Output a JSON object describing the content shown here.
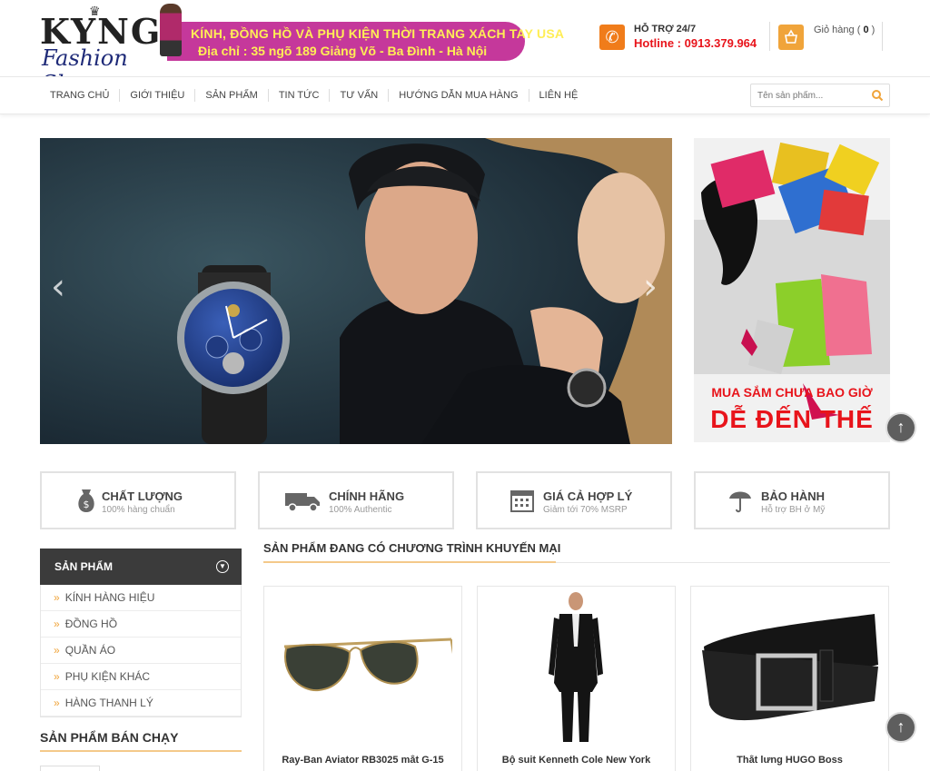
{
  "header": {
    "logo_main": "KYNG",
    "logo_sub": "Fashion Shop",
    "banner_line1": "KÍNH, ĐỒNG HỒ VÀ PHỤ KIỆN THỜI TRANG XÁCH TAY USA",
    "banner_line2": "Địa chỉ : 35 ngõ 189 Giảng Võ - Ba Đình - Hà Nội",
    "support_label": "HỖ TRỢ 24/7",
    "hotline": "Hotline : 0913.379.964",
    "cart_label": "Giỏ hàng (",
    "cart_count": "0",
    "cart_close": ")"
  },
  "nav": {
    "items": [
      "TRANG CHỦ",
      "GIỚI THIỆU",
      "SẢN PHẨM",
      "TIN TỨC",
      "TƯ VẤN",
      "HƯỚNG DẪN MUA HÀNG",
      "LIÊN HỆ"
    ],
    "search_placeholder": "Tên sản phẩm..."
  },
  "hero": {
    "side_banner_line1": "MUA SẮM CHƯA BAO GIỜ",
    "side_banner_line2": "DỄ ĐẾN THẾ",
    "arrow_prev": "‹",
    "arrow_next": "›"
  },
  "features": [
    {
      "title": "CHẤT LƯỢNG",
      "sub": "100% hàng chuẩn",
      "icon": "money-bag-icon"
    },
    {
      "title": "CHÍNH HÃNG",
      "sub": "100% Authentic",
      "icon": "truck-icon"
    },
    {
      "title": "GIÁ CẢ HỢP LÝ",
      "sub": "Giảm tới 70% MSRP",
      "icon": "calendar-icon"
    },
    {
      "title": "BẢO HÀNH",
      "sub": "Hỗ trợ BH ở Mỹ",
      "icon": "umbrella-icon"
    }
  ],
  "sidebar": {
    "title": "SẢN PHẨM",
    "items": [
      "KÍNH HÀNG HIỆU",
      "ĐỒNG HỒ",
      "QUẦN ÁO",
      "PHỤ KIỆN KHÁC",
      "HÀNG THANH LÝ"
    ],
    "best_title": "SẢN PHẨM BÁN CHẠY"
  },
  "promo": {
    "title": "SẢN PHẨM ĐANG CÓ CHƯƠNG TRÌNH KHUYẾN MẠI",
    "products": [
      {
        "name": "Ray-Ban Aviator RB3025 mắt G-15"
      },
      {
        "name": "Bộ suit Kenneth Cole New York"
      },
      {
        "name": "Thắt lưng HUGO Boss"
      }
    ]
  },
  "colors": {
    "accent": "#f07c1a",
    "hotline": "#e8141b",
    "banner": "#c5389b",
    "sidebar_head": "#3b3b3b"
  }
}
